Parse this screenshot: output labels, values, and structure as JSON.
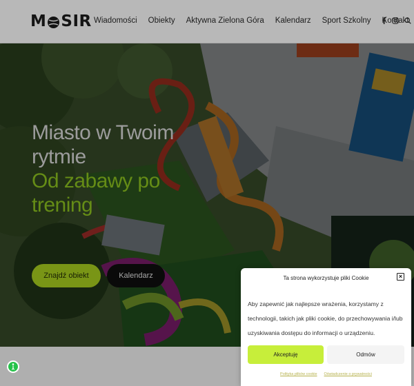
{
  "brand": {
    "logo_text_left": "M",
    "logo_text_right": "SIR",
    "accent": "#a8cf1f"
  },
  "nav": {
    "items": [
      {
        "label": "Wiadomości"
      },
      {
        "label": "Obiekty"
      },
      {
        "label": "Aktywna Zielona Góra"
      },
      {
        "label": "Kalendarz"
      },
      {
        "label": "Sport Szkolny"
      },
      {
        "label": "Kontakt"
      }
    ],
    "social": [
      "facebook-icon",
      "instagram-icon",
      "search-icon"
    ]
  },
  "hero": {
    "line1": "Miasto w Twoim",
    "line2": "rytmie",
    "line3": "Od zabawy po",
    "line4": "trening",
    "primary_button": "Znajdź obiekt",
    "secondary_button": "Kalendarz"
  },
  "cookie": {
    "title": "Ta strona wykorzystuje pliki Cookie",
    "body": "Aby zapewnić jak najlepsze wrażenia, korzystamy z technologii, takich jak pliki cookie, do przechowywania i/lub uzyskiwania dostępu do informacji o urządzeniu.",
    "accept": "Akceptuję",
    "deny": "Odmów",
    "link1": "Polityka plików cookie",
    "link2": "Oświadczenie o prywatności"
  }
}
